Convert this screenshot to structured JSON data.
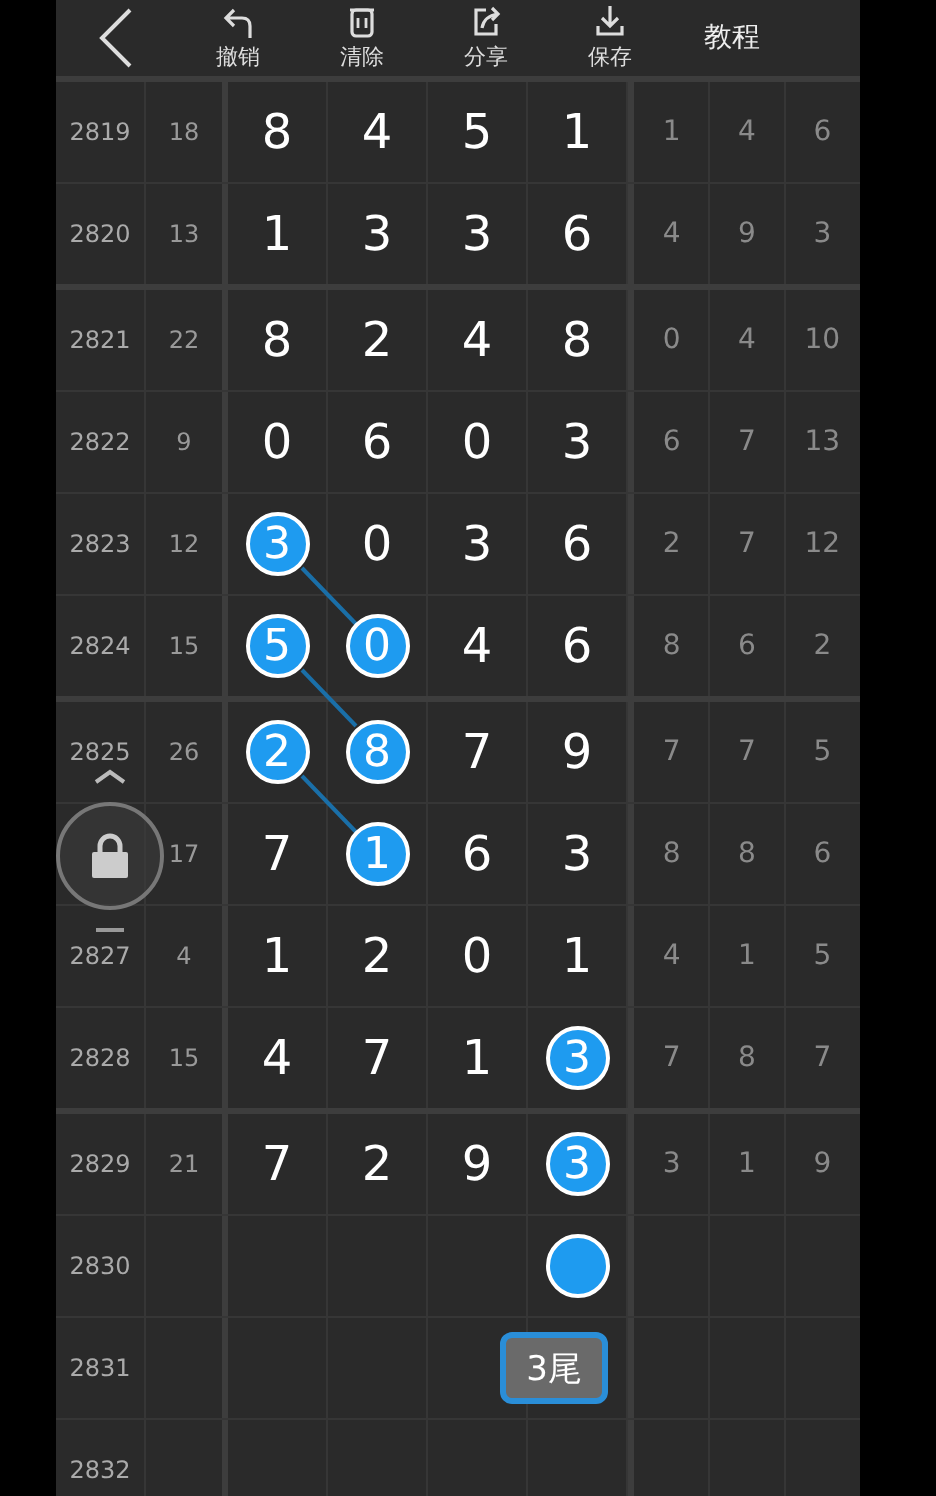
{
  "toolbar": {
    "actions": [
      {
        "kind": "undo",
        "label": "撤销"
      },
      {
        "kind": "clear",
        "label": "清除"
      },
      {
        "kind": "share",
        "label": "分享"
      },
      {
        "kind": "save",
        "label": "保存"
      }
    ],
    "tutorial": "教程"
  },
  "groups": [
    {
      "rows": [
        {
          "period": "2819",
          "sum": "18",
          "digits": [
            {
              "value": "8",
              "circled": false
            },
            {
              "value": "4",
              "circled": false
            },
            {
              "value": "5",
              "circled": false
            },
            {
              "value": "1",
              "circled": false
            }
          ],
          "tail": [
            "1",
            "4",
            "6"
          ]
        },
        {
          "period": "2820",
          "sum": "13",
          "digits": [
            {
              "value": "1",
              "circled": false
            },
            {
              "value": "3",
              "circled": false
            },
            {
              "value": "3",
              "circled": false
            },
            {
              "value": "6",
              "circled": false
            }
          ],
          "tail": [
            "4",
            "9",
            "3"
          ]
        }
      ]
    },
    {
      "rows": [
        {
          "period": "2821",
          "sum": "22",
          "digits": [
            {
              "value": "8",
              "circled": false
            },
            {
              "value": "2",
              "circled": false
            },
            {
              "value": "4",
              "circled": false
            },
            {
              "value": "8",
              "circled": false
            }
          ],
          "tail": [
            "0",
            "4",
            "10"
          ]
        },
        {
          "period": "2822",
          "sum": "9",
          "digits": [
            {
              "value": "0",
              "circled": false
            },
            {
              "value": "6",
              "circled": false
            },
            {
              "value": "0",
              "circled": false
            },
            {
              "value": "3",
              "circled": false
            }
          ],
          "tail": [
            "6",
            "7",
            "13"
          ]
        },
        {
          "period": "2823",
          "sum": "12",
          "digits": [
            {
              "value": "3",
              "circled": true,
              "linked_down_right": true
            },
            {
              "value": "0",
              "circled": false
            },
            {
              "value": "3",
              "circled": false
            },
            {
              "value": "6",
              "circled": false
            }
          ],
          "tail": [
            "2",
            "7",
            "12"
          ]
        },
        {
          "period": "2824",
          "sum": "15",
          "digits": [
            {
              "value": "5",
              "circled": true,
              "linked_down_right": true
            },
            {
              "value": "0",
              "circled": true
            },
            {
              "value": "4",
              "circled": false
            },
            {
              "value": "6",
              "circled": false
            }
          ],
          "tail": [
            "8",
            "6",
            "2"
          ]
        }
      ]
    },
    {
      "rows": [
        {
          "period": "2825",
          "sum": "26",
          "digits": [
            {
              "value": "2",
              "circled": true,
              "linked_down_right": true
            },
            {
              "value": "8",
              "circled": true
            },
            {
              "value": "7",
              "circled": false
            },
            {
              "value": "9",
              "circled": false
            }
          ],
          "tail": [
            "7",
            "7",
            "5"
          ]
        },
        {
          "sum": "17",
          "digits": [
            {
              "value": "7",
              "circled": false
            },
            {
              "value": "1",
              "circled": true
            },
            {
              "value": "6",
              "circled": false
            },
            {
              "value": "3",
              "circled": false
            }
          ],
          "tail": [
            "8",
            "8",
            "6"
          ]
        },
        {
          "period": "2827",
          "sum": "4",
          "digits": [
            {
              "value": "1",
              "circled": false
            },
            {
              "value": "2",
              "circled": false
            },
            {
              "value": "0",
              "circled": false
            },
            {
              "value": "1",
              "circled": false
            }
          ],
          "tail": [
            "4",
            "1",
            "5"
          ]
        },
        {
          "period": "2828",
          "sum": "15",
          "digits": [
            {
              "value": "4",
              "circled": false
            },
            {
              "value": "7",
              "circled": false
            },
            {
              "value": "1",
              "circled": false
            },
            {
              "value": "3",
              "circled": true
            }
          ],
          "tail": [
            "7",
            "8",
            "7"
          ]
        }
      ]
    },
    {
      "rows": [
        {
          "period": "2829",
          "sum": "21",
          "digits": [
            {
              "value": "7",
              "circled": false
            },
            {
              "value": "2",
              "circled": false
            },
            {
              "value": "9",
              "circled": false
            },
            {
              "value": "3",
              "circled": true
            }
          ],
          "tail": [
            "3",
            "1",
            "9"
          ]
        },
        {
          "period": "2830",
          "digits": [
            {
              "circled": false
            },
            {
              "circled": false
            },
            {
              "circled": false
            },
            {
              "circled": true
            }
          ]
        },
        {
          "period": "2831",
          "digits": [
            {
              "circled": false
            },
            {
              "circled": false
            },
            {
              "circled": false
            },
            {
              "circled": false,
              "badge": "3尾"
            }
          ]
        },
        {
          "period": "2832",
          "digits": [
            {
              "circled": false
            },
            {
              "circled": false
            },
            {
              "circled": false
            },
            {
              "circled": false
            }
          ]
        }
      ]
    }
  ],
  "lock_button": {
    "locked": true
  }
}
